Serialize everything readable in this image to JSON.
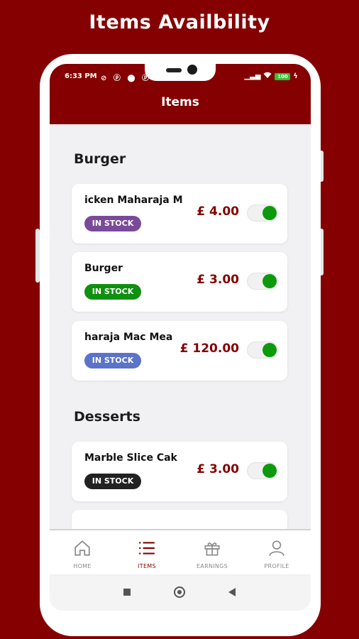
{
  "promo": {
    "title": "Items Availbility"
  },
  "status_bar": {
    "time": "6:33 PM",
    "battery": "100"
  },
  "appbar": {
    "title": "Items"
  },
  "sections": [
    {
      "title": "Burger",
      "items": [
        {
          "name": "Chicken Maharaja Mac",
          "visible_name": "icken Maharaja M",
          "price": "£ 4.00",
          "badge": "IN STOCK",
          "badge_color": "#7a4a9a",
          "available": true
        },
        {
          "name": "Burger",
          "visible_name": "Burger",
          "price": "£ 3.00",
          "badge": "IN STOCK",
          "badge_color": "#109010",
          "available": true
        },
        {
          "name": "Maharaja Mac Meal",
          "visible_name": "haraja Mac Mea",
          "price": "£ 120.00",
          "badge": "IN STOCK",
          "badge_color": "#5b73c9",
          "available": true
        }
      ]
    },
    {
      "title": "Desserts",
      "items": [
        {
          "name": "Marble Slice Cake",
          "visible_name": "Marble Slice Cak",
          "price": "£ 3.00",
          "badge": "IN STOCK",
          "badge_color": "#222222",
          "available": true
        }
      ]
    }
  ],
  "bottom_nav": [
    {
      "label": "HOME",
      "icon": "home-icon",
      "active": false
    },
    {
      "label": "ITEMS",
      "icon": "list-icon",
      "active": true
    },
    {
      "label": "EARNINGS",
      "icon": "gift-icon",
      "active": false
    },
    {
      "label": "PROFILE",
      "icon": "person-icon",
      "active": false
    }
  ],
  "colors": {
    "brand": "#850000",
    "toggle_on": "#0c9a0c"
  }
}
